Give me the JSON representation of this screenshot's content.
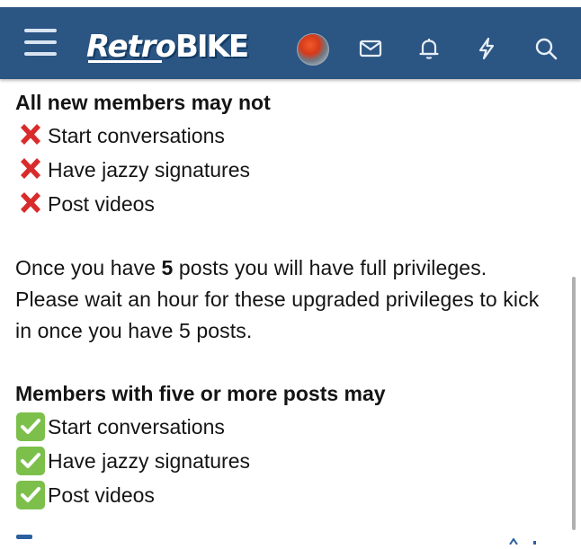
{
  "header": {
    "logo_part1": "Retro",
    "logo_part2": "BIKE",
    "icons": [
      "menu-icon",
      "avatar",
      "envelope-icon",
      "bell-icon",
      "lightning-icon",
      "search-icon"
    ],
    "bg_color": "#2b5583"
  },
  "content": {
    "new_members_heading": "All new members may not",
    "new_members_restrictions": [
      {
        "icon": "cross-mark-icon",
        "text": "Start conversations"
      },
      {
        "icon": "cross-mark-icon",
        "text": "Have jazzy signatures"
      },
      {
        "icon": "cross-mark-icon",
        "text": "Post videos"
      }
    ],
    "para_prefix": "Once you have ",
    "para_bold": "5",
    "para_rest": " posts you will have full privileges. Please wait an hour for these upgraded privileges to kick in once you have 5 posts.",
    "full_members_heading": "Members with five or more posts may",
    "full_members_privileges": [
      {
        "icon": "check-mark-icon",
        "text": "Start conversations"
      },
      {
        "icon": "check-mark-icon",
        "text": "Have jazzy signatures"
      },
      {
        "icon": "check-mark-icon",
        "text": "Post videos"
      }
    ]
  },
  "colors": {
    "cross": "#d92b2b",
    "check_bg": "#7cc04b",
    "text": "#141414"
  }
}
